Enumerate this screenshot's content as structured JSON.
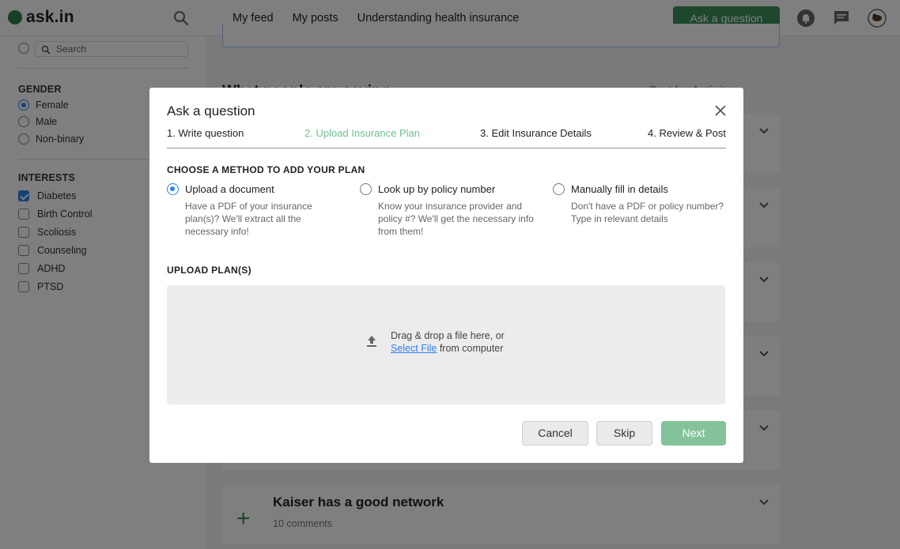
{
  "header": {
    "logo_text": "ask.in",
    "tabs": [
      {
        "label": "My feed",
        "active": true
      },
      {
        "label": "My posts",
        "active": false
      },
      {
        "label": "Understanding health insurance",
        "active": false
      }
    ],
    "ask_button_label": "Ask a question",
    "icons": [
      "search-icon",
      "bell-icon",
      "chat-icon",
      "avatar-icon"
    ]
  },
  "sidebar": {
    "search_placeholder": "Search",
    "gender_heading": "GENDER",
    "gender_options": [
      {
        "label": "Female",
        "selected": true
      },
      {
        "label": "Male",
        "selected": false
      },
      {
        "label": "Non-binary",
        "selected": false
      }
    ],
    "interests_heading": "INTERESTS",
    "interests": [
      {
        "label": "Diabetes",
        "checked": true
      },
      {
        "label": "Birth Control",
        "checked": false
      },
      {
        "label": "Scoliosis",
        "checked": false
      },
      {
        "label": "Counseling",
        "checked": false
      },
      {
        "label": "ADHD",
        "checked": false
      },
      {
        "label": "PTSD",
        "checked": false
      }
    ]
  },
  "feed": {
    "heading": "What people are saying",
    "sort_label": "Sort by Activity",
    "last_card": {
      "title": "Kaiser has a good network",
      "subtitle": "10 comments"
    }
  },
  "modal": {
    "title": "Ask a question",
    "steps": [
      {
        "label": "1. Write question",
        "active": false
      },
      {
        "label": "2. Upload Insurance Plan",
        "active": true
      },
      {
        "label": "3. Edit Insurance Details",
        "active": false
      },
      {
        "label": "4. Review & Post",
        "active": false
      }
    ],
    "method_heading": "CHOOSE A METHOD TO ADD YOUR PLAN",
    "methods": [
      {
        "label": "Upload a document",
        "desc": "Have a PDF of your insurance plan(s)? We'll extract all the necessary info!",
        "selected": true
      },
      {
        "label": "Look up by policy number",
        "desc": "Know your insurance provider and policy #? We'll get the necessary info from them!",
        "selected": false
      },
      {
        "label": "Manually fill in details",
        "desc": "Don't have a PDF or policy number? Type in relevant details",
        "selected": false
      }
    ],
    "upload_heading": "UPLOAD PLAN(S)",
    "dropzone": {
      "line1": "Drag & drop a file here, or",
      "link": "Select File",
      "line2_rest": " from computer"
    },
    "buttons": {
      "cancel": "Cancel",
      "skip": "Skip",
      "next": "Next"
    }
  },
  "colors": {
    "brand_green": "#3d8f5d",
    "active_step": "#6fbf8c",
    "link_blue": "#2f80ed",
    "next_disabled": "#84c29b"
  }
}
